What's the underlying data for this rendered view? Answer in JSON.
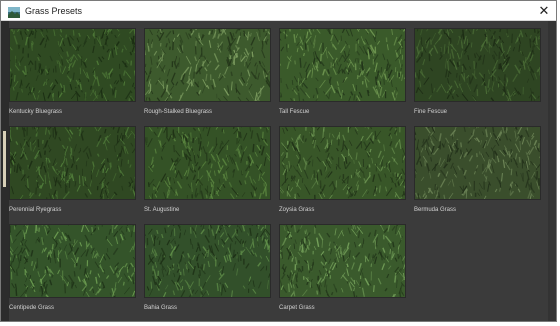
{
  "window": {
    "title": "Grass Presets",
    "close_glyph": "✕",
    "title_icon": "landscape-icon"
  },
  "presets": [
    {
      "label": "Kentucky Bluegrass",
      "base": "#2f4a22",
      "light": "#4f7a38",
      "dark": "#1b2e13"
    },
    {
      "label": "Rough-Stalked Bluegrass",
      "base": "#3d5a2d",
      "light": "#7a9a5e",
      "dark": "#24361a"
    },
    {
      "label": "Tall Fescue",
      "base": "#3a5a2a",
      "light": "#6e9650",
      "dark": "#22351a"
    },
    {
      "label": "Fine Fescue",
      "base": "#2e4522",
      "light": "#4a6c36",
      "dark": "#1d2c15"
    },
    {
      "label": "Perennial Ryegrass",
      "base": "#2f4822",
      "light": "#507c3a",
      "dark": "#1c2d14"
    },
    {
      "label": "St. Augustine",
      "base": "#345226",
      "light": "#5b8640",
      "dark": "#1f3116"
    },
    {
      "label": "Zoysia Grass",
      "base": "#385628",
      "light": "#6a9250",
      "dark": "#213318"
    },
    {
      "label": "Bermuda Grass",
      "base": "#3a4e2c",
      "light": "#6c8456",
      "dark": "#22301a"
    },
    {
      "label": "Centipede Grass",
      "base": "#34542a",
      "light": "#6a9a50",
      "dark": "#1f3318"
    },
    {
      "label": "Bahia Grass",
      "base": "#32502a",
      "light": "#5e8c48",
      "dark": "#1d3016"
    },
    {
      "label": "Carpet Grass",
      "base": "#3a5a2c",
      "light": "#74a05a",
      "dark": "#22361a"
    }
  ]
}
